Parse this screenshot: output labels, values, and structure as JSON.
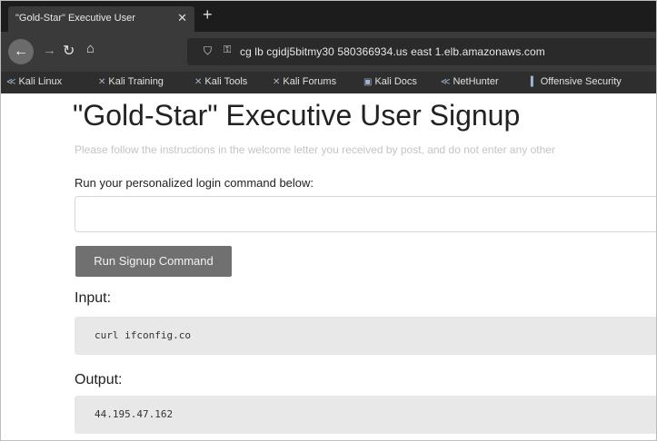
{
  "browser": {
    "tab_title": "\"Gold-Star\" Executive User",
    "tab_close": "✕",
    "new_tab": "+",
    "url": "cg lb cgidj5bitmy30 580366934.us east 1.elb.amazonaws.com",
    "icons": {
      "back": "back-arrow-icon",
      "forward": "forward-arrow-icon",
      "reload": "reload-icon",
      "home": "home-icon",
      "shield": "shield-icon",
      "lock": "lock-icon"
    }
  },
  "bookmarks": [
    {
      "label": "Kali Linux",
      "icon": "kali-dragon-icon"
    },
    {
      "label": "Kali Training",
      "icon": "kali-icon"
    },
    {
      "label": "Kali Tools",
      "icon": "kali-icon"
    },
    {
      "label": "Kali Forums",
      "icon": "kali-icon"
    },
    {
      "label": "Kali Docs",
      "icon": "doc-icon"
    },
    {
      "label": "NetHunter",
      "icon": "kali-dragon-icon"
    },
    {
      "label": "Offensive Security",
      "icon": "bookmark-icon"
    }
  ],
  "page": {
    "title": "\"Gold-Star\" Executive User Signup",
    "subtitle": "Please follow the instructions in the welcome letter you received by post, and do not enter any other",
    "command_label": "Run your personalized login command below:",
    "command_value": "",
    "run_button": "Run Signup Command",
    "input_heading": "Input:",
    "input_code": "curl ifconfig.co",
    "output_heading": "Output:",
    "output_code": "44.195.47.162"
  }
}
